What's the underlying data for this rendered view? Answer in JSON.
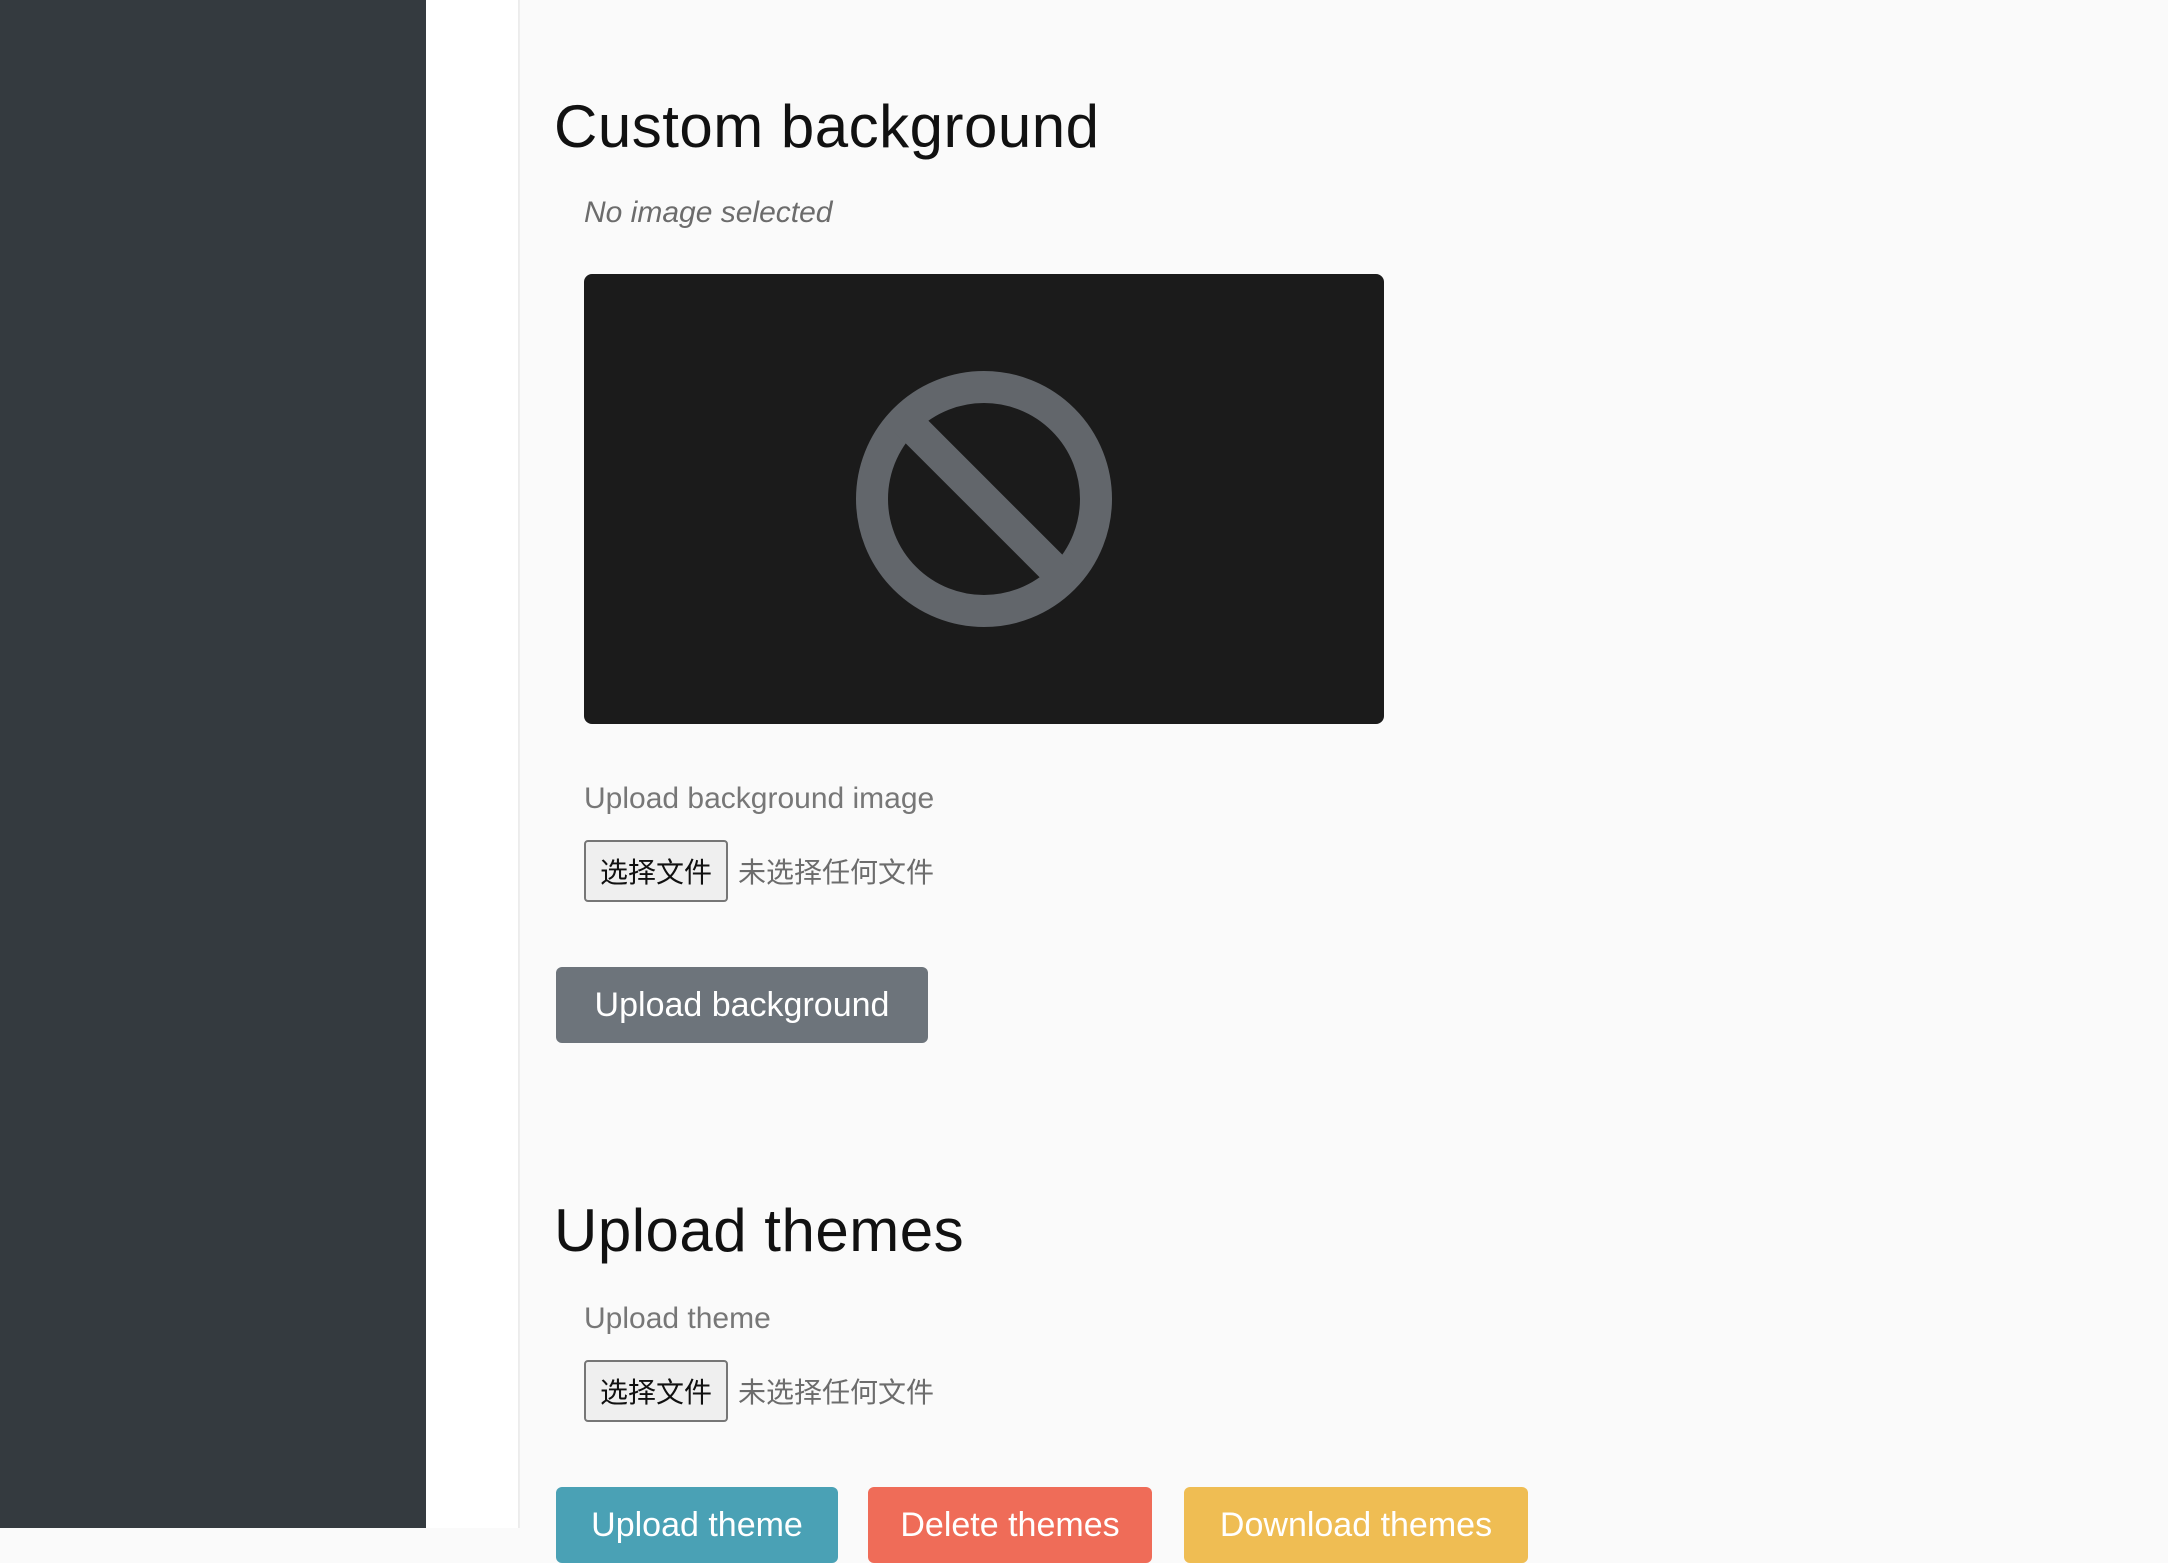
{
  "background_section": {
    "title": "Custom background",
    "status": "No image selected",
    "preview_icon": "no-image-icon",
    "upload_label": "Upload background image",
    "file_button": "选择文件",
    "file_status": "未选择任何文件",
    "upload_button": "Upload background"
  },
  "themes_section": {
    "title": "Upload themes",
    "upload_label": "Upload theme",
    "file_button": "选择文件",
    "file_status": "未选择任何文件",
    "buttons": {
      "upload": "Upload theme",
      "delete": "Delete themes",
      "download": "Download themes"
    }
  },
  "colors": {
    "sidebar": "#343a3f",
    "secondary": "#6d747b",
    "info": "#4aa1b5",
    "danger": "#ef6c58",
    "warning": "#efbd53"
  }
}
